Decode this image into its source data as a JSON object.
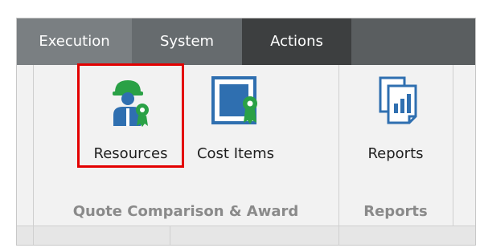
{
  "tabs": {
    "execution": "Execution",
    "system": "System",
    "actions": "Actions"
  },
  "ribbon": {
    "buttons": {
      "resources": "Resources",
      "cost_items": "Cost Items",
      "reports": "Reports"
    },
    "groups": {
      "quote_comparison": "Quote Comparison & Award",
      "reports": "Reports"
    }
  },
  "icons": {
    "resources": "worker-award-icon",
    "cost_items": "certificate-award-icon",
    "reports": "report-chart-icon"
  },
  "colors": {
    "accent_blue": "#2f6fb0",
    "award_green": "#2aa146",
    "highlight_red": "#e30000"
  }
}
